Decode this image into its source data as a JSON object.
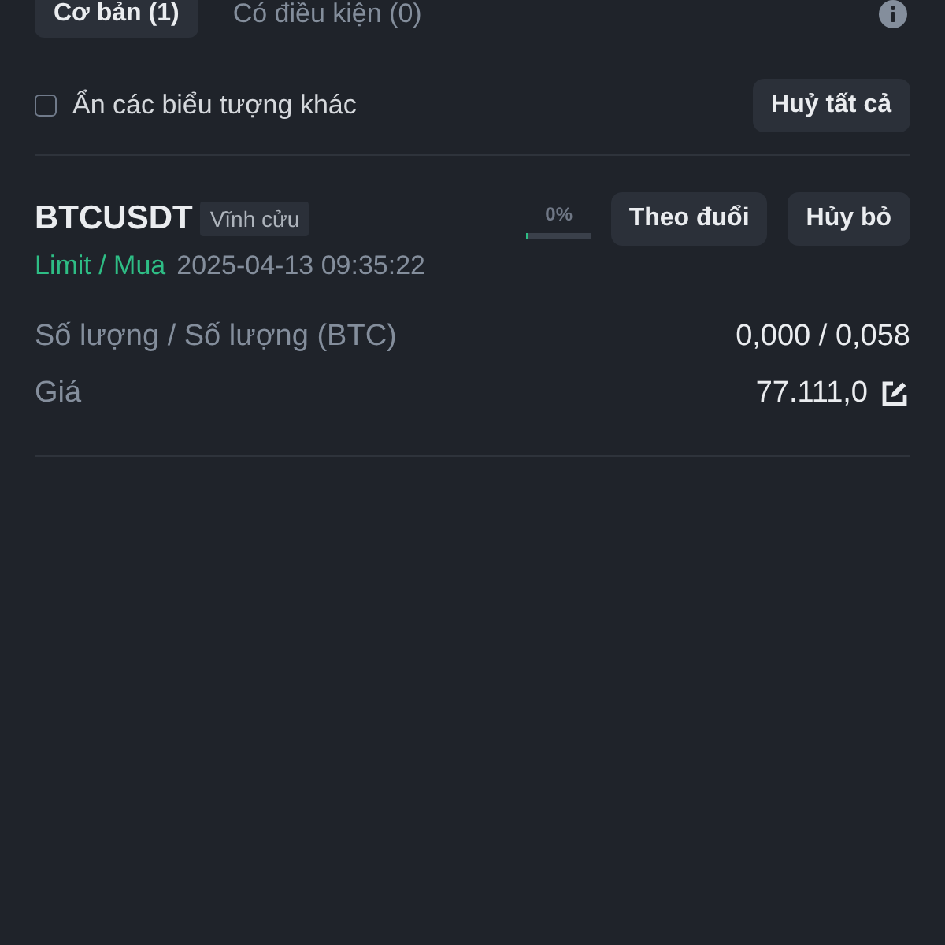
{
  "tabs": [
    {
      "label": "Cơ bản (1)",
      "selected": true
    },
    {
      "label": "Có điều kiện (0)",
      "selected": false
    }
  ],
  "filter": {
    "label": "Ẩn các biểu tượng khác",
    "checked": false
  },
  "cancel_all_button": "Huỷ tất cả",
  "orders": [
    {
      "symbol": "BTCUSDT",
      "badge": "Vĩnh cửu",
      "type": "Limit / Mua",
      "time": "2025-04-13 09:35:22",
      "progress": {
        "reading": "0%",
        "level": 0
      },
      "buttons": [
        "Theo đuổi",
        "Hủy bỏ"
      ],
      "fields": [
        {
          "label": "Số lượng / Số lượng (BTC)",
          "value": "0,000 / 0,058",
          "editable": false
        },
        {
          "label": "Giá",
          "value": "77.111,0",
          "editable": true
        }
      ]
    }
  ]
}
